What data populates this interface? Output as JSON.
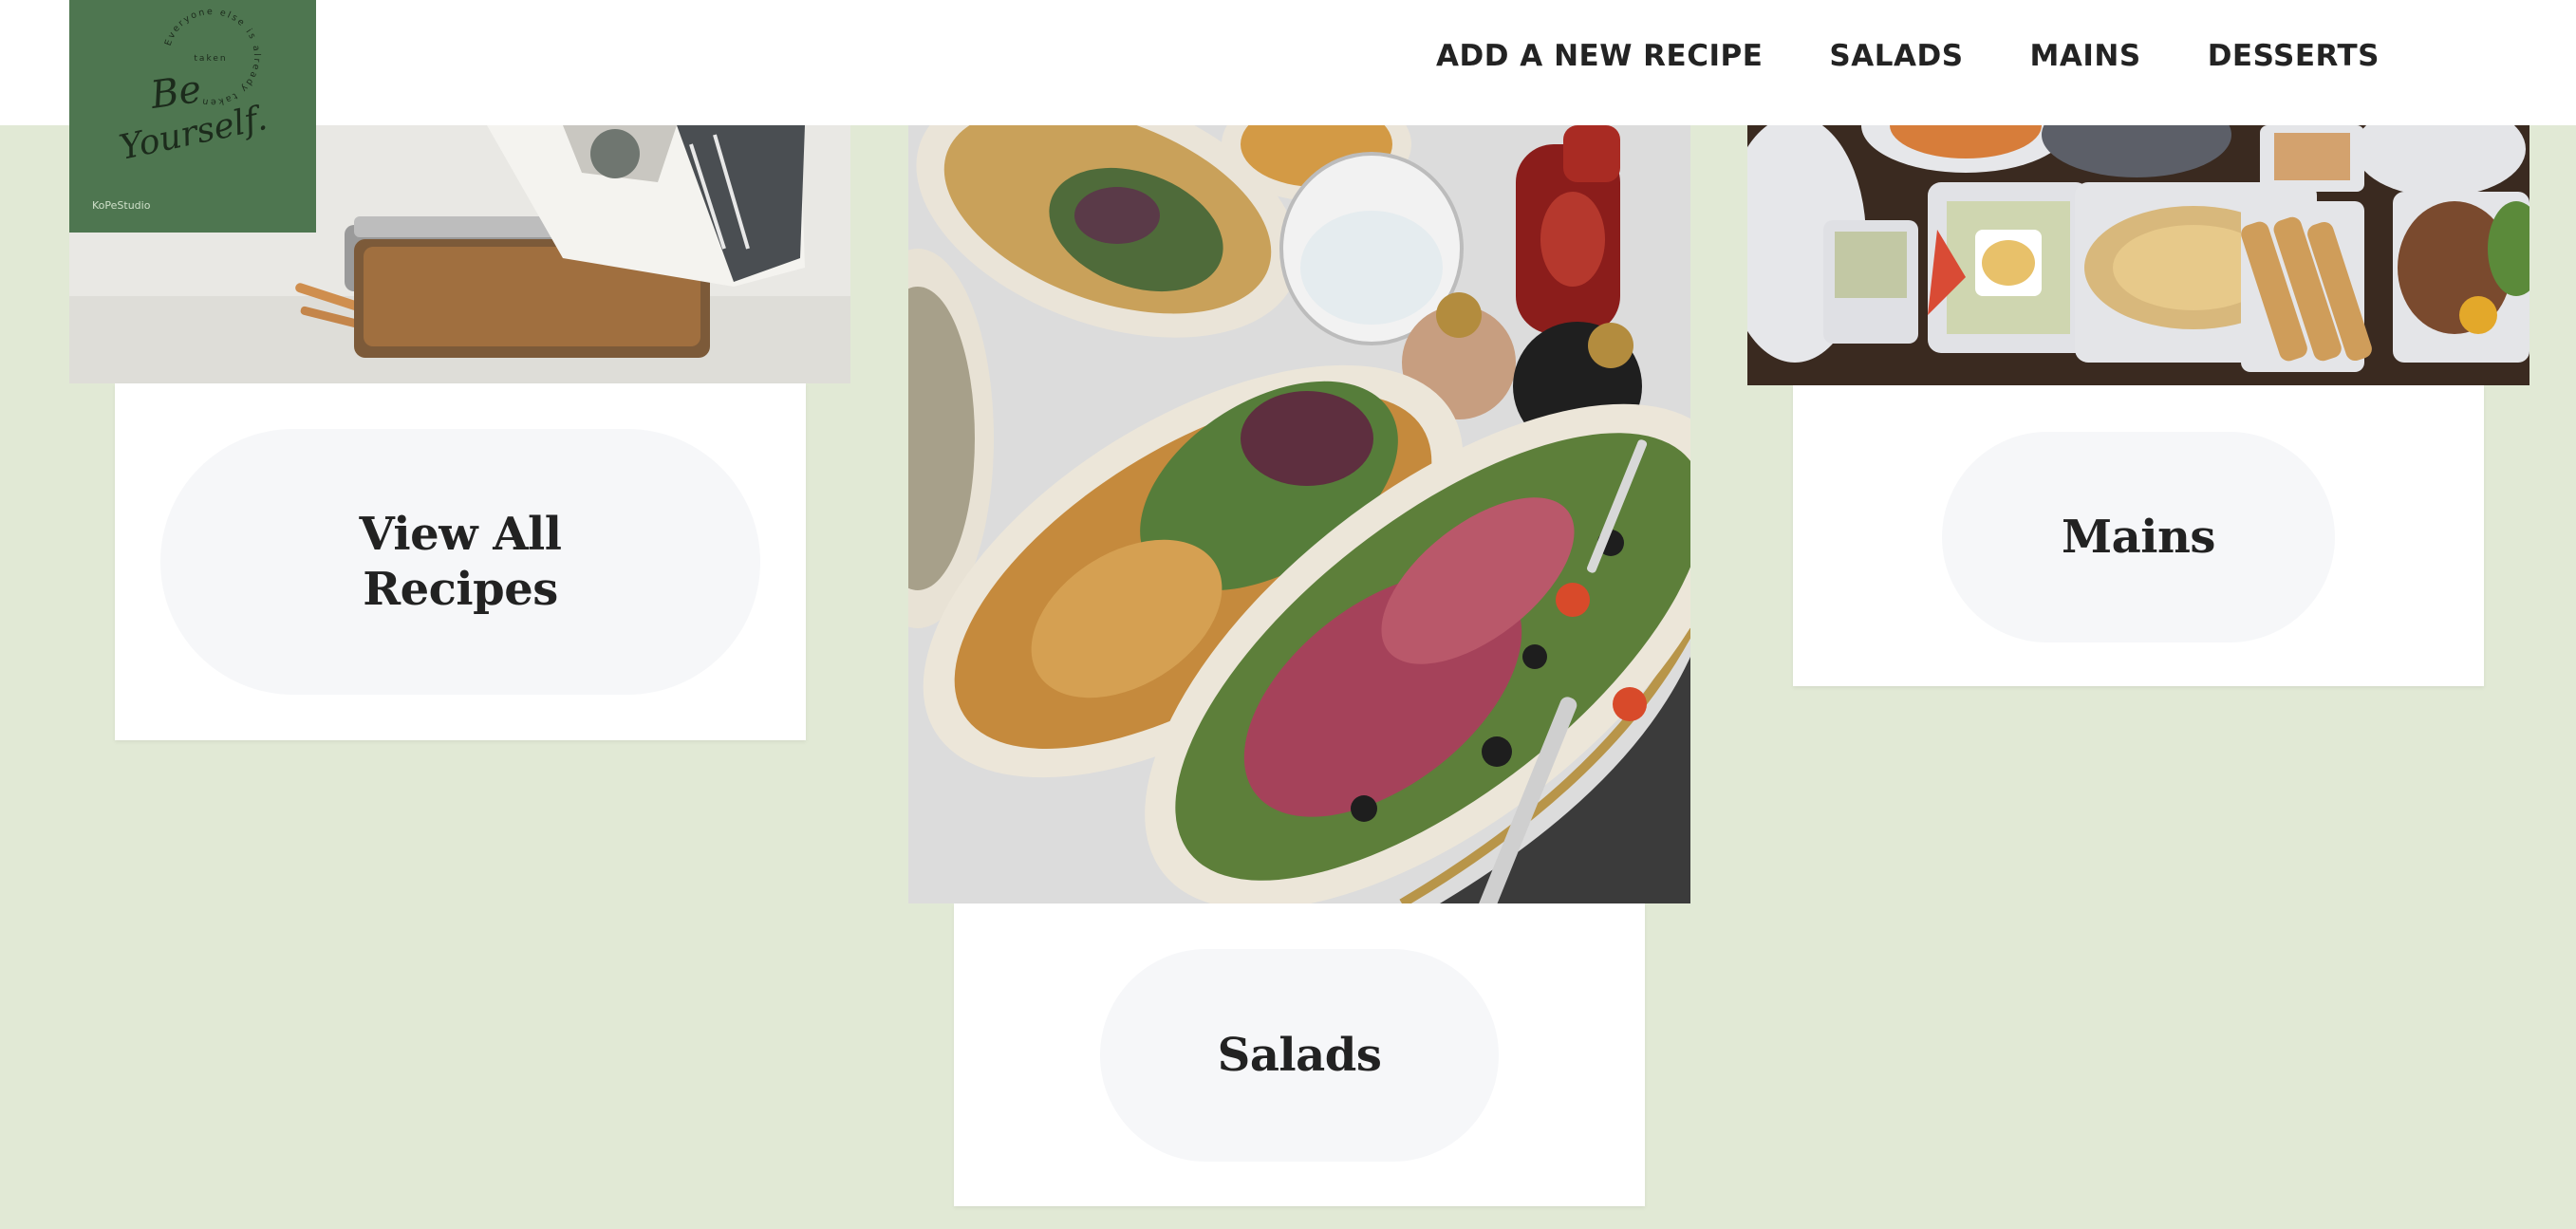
{
  "nav": {
    "items": [
      {
        "label": "ADD A NEW RECIPE"
      },
      {
        "label": "SALADS"
      },
      {
        "label": "MAINS"
      },
      {
        "label": "DESSERTS"
      }
    ]
  },
  "logo": {
    "script_text_1": "Be",
    "script_text_2": "Yourself.",
    "ring_text": "Everyone else is already taken",
    "center_text": "taken",
    "studio": "KoPeStudio"
  },
  "cards": {
    "view_all": {
      "line1": "View All",
      "line2": "Recipes"
    },
    "mains": {
      "label": "Mains"
    },
    "salads": {
      "label": "Salads"
    }
  },
  "colors": {
    "page_background": "#e1e9d5",
    "logo_background": "#4e7650",
    "pill_background": "#f6f7f9"
  }
}
